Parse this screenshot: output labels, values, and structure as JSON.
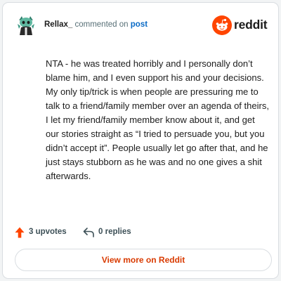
{
  "comment": {
    "author": "Rellax_",
    "action_text": "commented on",
    "target_link": "post",
    "body": "NTA - he was treated horribly and I personally don’t blame him, and I even support his and your decisions. My only tip/trick is when people are pressuring me to talk to a friend/family member over an agenda of theirs, I let my friend/family member know about it, and get our stories straight as “I tried to persuade you, but you didn’t accept it”. People usually let go after that, and he just stays stubborn as he was and no one gives a shit afterwards."
  },
  "brand": {
    "logo_word": "reddit",
    "logo_icon": "reddit-snoo-icon",
    "accent_color": "#ff4500"
  },
  "actions": {
    "upvotes_label": "3 upvotes",
    "upvote_icon": "upvote-arrow-icon",
    "replies_label": "0 replies",
    "reply_icon": "reply-arrow-icon"
  },
  "cta": {
    "label": "View more on Reddit",
    "color": "#d93a00"
  }
}
